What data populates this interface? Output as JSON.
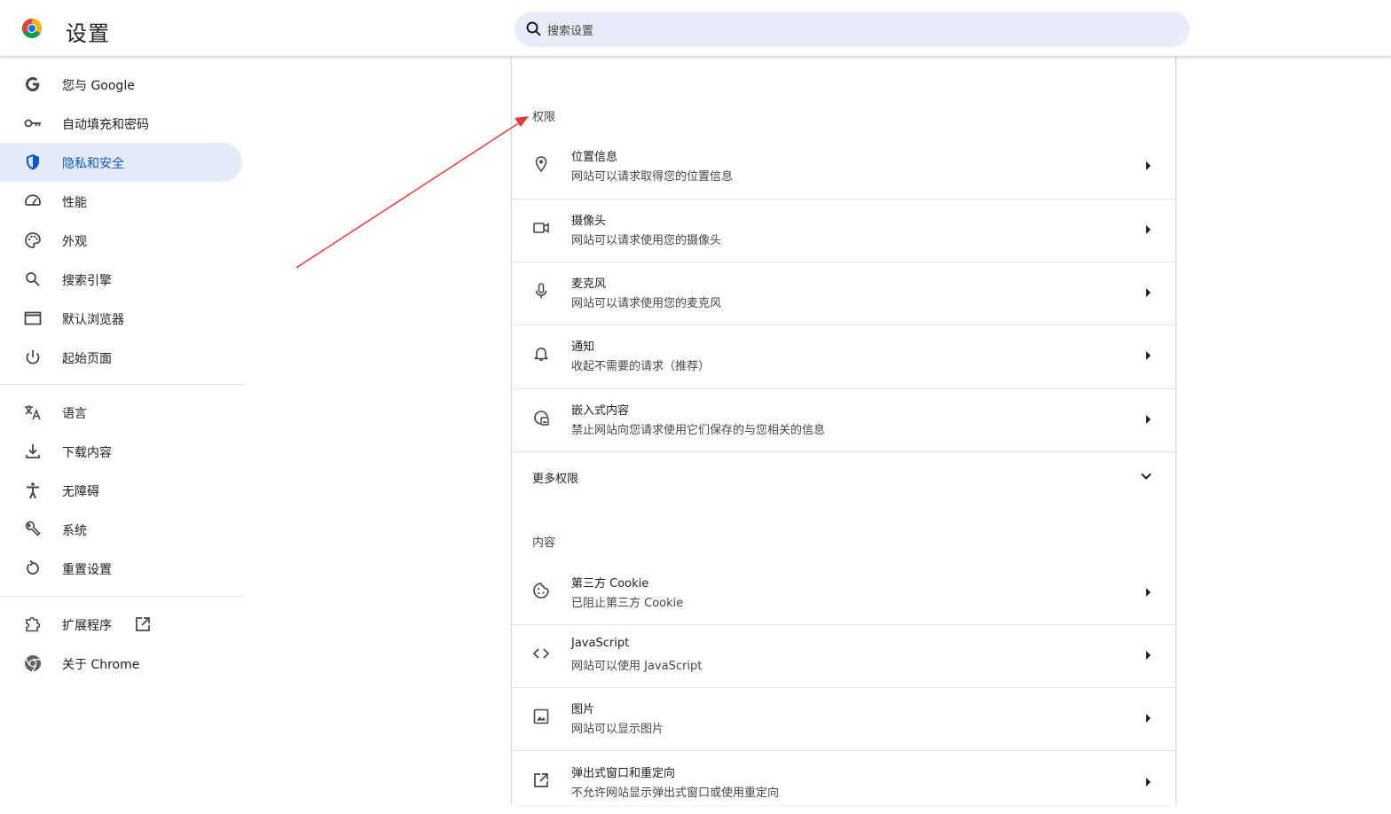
{
  "app": {
    "title": "设置",
    "logo_icon": "chrome-logo-icon",
    "accent_color": "#0b57d0"
  },
  "search": {
    "placeholder": "搜索设置",
    "icon": "search-icon"
  },
  "sidebar": {
    "items": [
      {
        "label": "您与 Google",
        "icon": "google-g-icon"
      },
      {
        "label": "自动填充和密码",
        "icon": "key-icon"
      },
      {
        "label": "隐私和安全",
        "icon": "shield-icon",
        "active": true
      },
      {
        "label": "性能",
        "icon": "speedometer-icon"
      },
      {
        "label": "外观",
        "icon": "palette-icon"
      },
      {
        "label": "搜索引擎",
        "icon": "search-icon"
      },
      {
        "label": "默认浏览器",
        "icon": "browser-window-icon"
      },
      {
        "label": "起始页面",
        "icon": "power-icon"
      },
      {
        "label": "语言",
        "icon": "translate-icon"
      },
      {
        "label": "下载内容",
        "icon": "download-icon"
      },
      {
        "label": "无障碍",
        "icon": "accessibility-icon"
      },
      {
        "label": "系统",
        "icon": "wrench-icon"
      },
      {
        "label": "重置设置",
        "icon": "reset-icon"
      },
      {
        "label": "扩展程序",
        "icon": "extension-icon",
        "external_icon": "open-in-new-icon"
      },
      {
        "label": "关于 Chrome",
        "icon": "chrome-icon"
      }
    ]
  },
  "permissions": {
    "heading": "权限",
    "rows": [
      {
        "title": "位置信息",
        "subtitle": "网站可以请求取得您的位置信息",
        "icon": "location-pin-icon"
      },
      {
        "title": "摄像头",
        "subtitle": "网站可以请求使用您的摄像头",
        "icon": "camera-icon"
      },
      {
        "title": "麦克风",
        "subtitle": "网站可以请求使用您的麦克风",
        "icon": "microphone-icon"
      },
      {
        "title": "通知",
        "subtitle": "收起不需要的请求（推荐）",
        "icon": "bell-icon"
      },
      {
        "title": "嵌入式内容",
        "subtitle": "禁止网站向您请求使用它们保存的与您相关的信息",
        "icon": "embedded-content-icon"
      }
    ],
    "more_label": "更多权限"
  },
  "content": {
    "heading": "内容",
    "rows": [
      {
        "title": "第三方 Cookie",
        "subtitle": "已阻止第三方 Cookie",
        "icon": "cookie-icon"
      },
      {
        "title": "JavaScript",
        "subtitle": "网站可以使用 JavaScript",
        "icon": "code-icon"
      },
      {
        "title": "图片",
        "subtitle": "网站可以显示图片",
        "icon": "image-icon"
      },
      {
        "title": "弹出式窗口和重定向",
        "subtitle": "不允许网站显示弹出式窗口或使用重定向",
        "icon": "open-in-new-icon"
      }
    ]
  },
  "annotation": {
    "arrow_color": "#e53935"
  }
}
